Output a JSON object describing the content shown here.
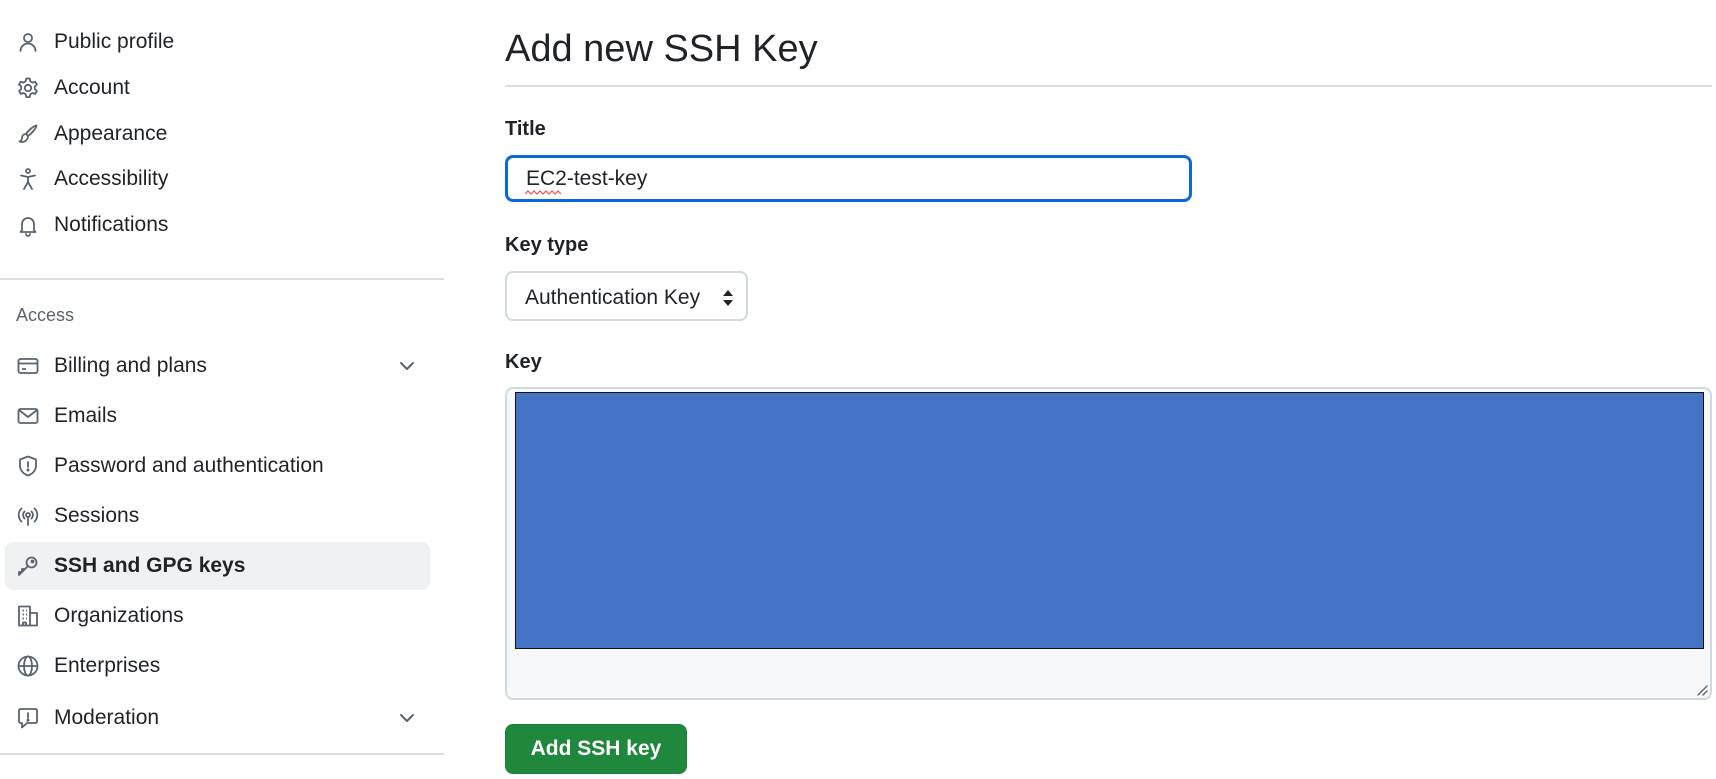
{
  "sidebar": {
    "top_items": [
      {
        "label": "Public profile",
        "icon": "person-icon"
      },
      {
        "label": "Account",
        "icon": "gear-icon"
      },
      {
        "label": "Appearance",
        "icon": "paintbrush-icon"
      },
      {
        "label": "Accessibility",
        "icon": "accessibility-icon"
      },
      {
        "label": "Notifications",
        "icon": "bell-icon"
      }
    ],
    "access_section_label": "Access",
    "access_items": [
      {
        "label": "Billing and plans",
        "icon": "credit-card-icon",
        "expandable": true
      },
      {
        "label": "Emails",
        "icon": "mail-icon"
      },
      {
        "label": "Password and authentication",
        "icon": "shield-icon"
      },
      {
        "label": "Sessions",
        "icon": "broadcast-icon"
      },
      {
        "label": "SSH and GPG keys",
        "icon": "key-icon",
        "active": true
      },
      {
        "label": "Organizations",
        "icon": "organization-icon"
      },
      {
        "label": "Enterprises",
        "icon": "globe-icon"
      },
      {
        "label": "Moderation",
        "icon": "report-icon",
        "expandable": true
      }
    ]
  },
  "main": {
    "page_title": "Add new SSH Key",
    "title_field": {
      "label": "Title",
      "value": "EC2-test-key"
    },
    "key_type_field": {
      "label": "Key type",
      "selected": "Authentication Key"
    },
    "key_field": {
      "label": "Key",
      "value": ""
    },
    "submit_label": "Add SSH key"
  },
  "colors": {
    "accent_blue": "#0969da",
    "primary_green": "#1f883d",
    "redaction_blue": "#4472c4",
    "active_nav_bg": "#f0f1f3"
  }
}
